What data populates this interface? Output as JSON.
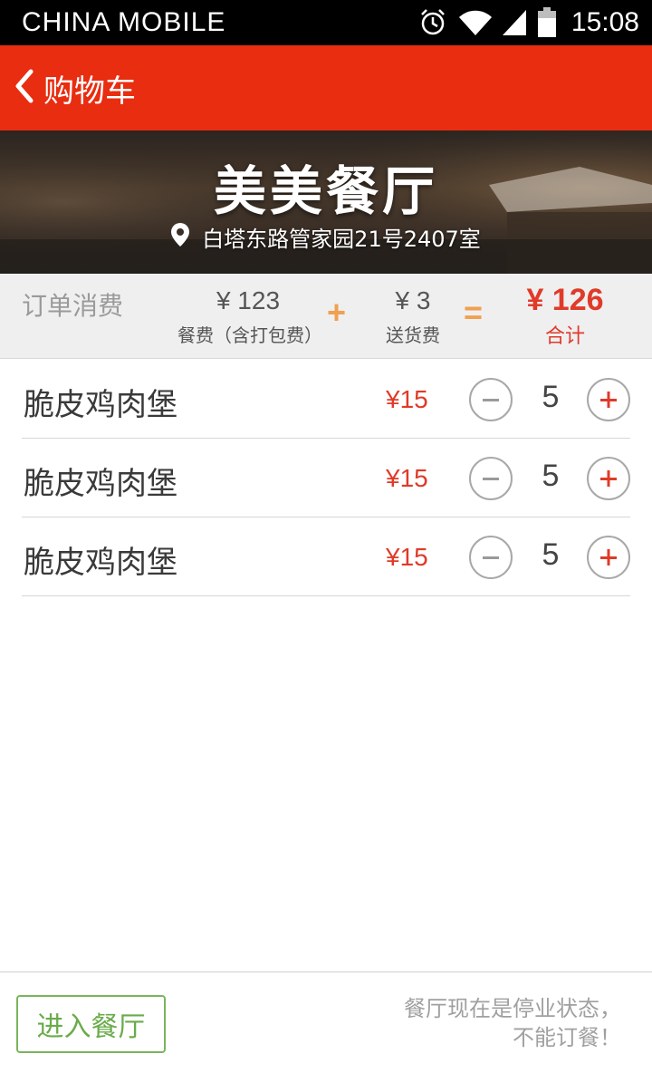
{
  "status_bar": {
    "carrier": "CHINA  MOBILE",
    "time": "15:08",
    "icons": [
      "alarm-icon",
      "wifi-icon",
      "signal-icon",
      "battery-icon"
    ]
  },
  "nav": {
    "back_icon": "chevron-left-icon",
    "title": "购物车",
    "color": "#e82d11"
  },
  "restaurant": {
    "name": "美美餐厅",
    "address_icon": "location-pin-icon",
    "address": "白塔东路管家园21号2407室"
  },
  "summary": {
    "label": "订单消费",
    "food_fee": {
      "value": "¥  123",
      "caption": "餐费（含打包费）"
    },
    "plus": "+",
    "delivery_fee": {
      "value": "¥ 3",
      "caption": "送货费"
    },
    "equals": "=",
    "total": {
      "value": "¥ 126",
      "caption": "合计"
    },
    "accent_color": "#e03a28",
    "operator_color": "#f0a050"
  },
  "items": [
    {
      "name": "脆皮鸡肉堡",
      "price": "¥15",
      "quantity": "5"
    },
    {
      "name": "脆皮鸡肉堡",
      "price": "¥15",
      "quantity": "5"
    },
    {
      "name": "脆皮鸡肉堡",
      "price": "¥15",
      "quantity": "5"
    }
  ],
  "footer": {
    "enter_button": "进入餐厅",
    "notice_line1": "餐厅现在是停业状态，",
    "notice_line2": "不能订餐！",
    "button_color": "#6aab4a"
  }
}
